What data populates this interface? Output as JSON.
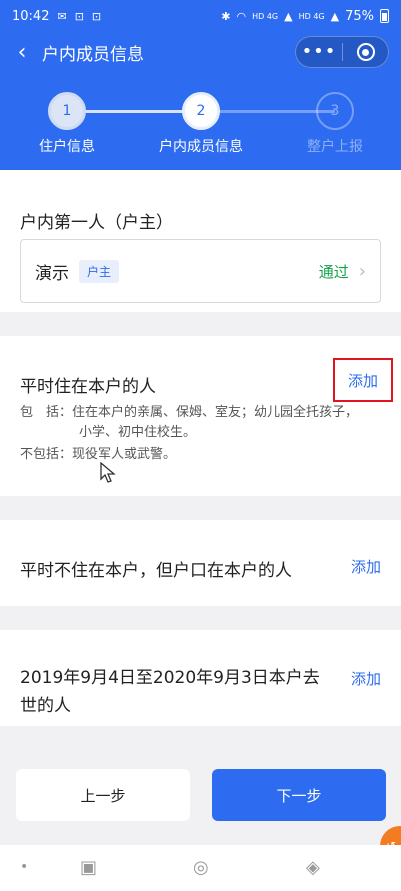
{
  "status_bar": {
    "time": "10:42",
    "left_icons": [
      "chat-icon",
      "scan-icon",
      "scan-icon"
    ],
    "right_icons": [
      "bluetooth-icon",
      "wifi-icon",
      "signal-icon",
      "signal-icon"
    ],
    "hd1": "HD 4G",
    "hd2": "HD 4G",
    "battery": "75%"
  },
  "header": {
    "back_glyph": "‹",
    "title": "户内成员信息",
    "capsule_dots": "•••"
  },
  "steps": [
    {
      "number": "1",
      "label": "住户信息",
      "state": "done"
    },
    {
      "number": "2",
      "label": "户内成员信息",
      "state": "active"
    },
    {
      "number": "3",
      "label": "整户上报",
      "state": "pending"
    }
  ],
  "section_head": {
    "title": "户内第一人（户主）",
    "member": {
      "name": "演示",
      "tag": "户主",
      "status": "通过",
      "chevron": "›"
    }
  },
  "section_resident": {
    "title": "平时住在本户的人",
    "add_label": "添加",
    "include_line1": "包　括：住在本户的亲属、保姆、室友；幼儿园全托孩子，",
    "include_line2": "小学、初中住校生。",
    "exclude_line": "不包括：现役军人或武警。"
  },
  "section_registered": {
    "title": "平时不住在本户，但户口在本户的人",
    "add_label": "添加"
  },
  "section_deceased": {
    "title": "2019年9月4日至2020年9月3日本户去世的人",
    "add_label": "添加"
  },
  "buttons": {
    "prev": "上一步",
    "next": "下一步"
  },
  "colors": {
    "primary": "#2d6cf0",
    "success": "#12a14b",
    "highlight_border": "#e0151f"
  }
}
